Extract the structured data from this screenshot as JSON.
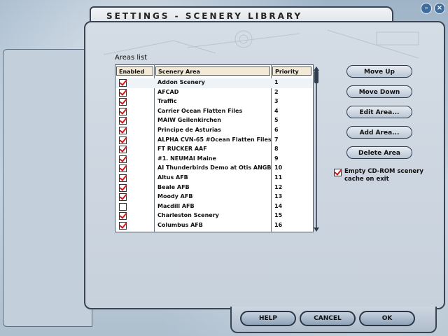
{
  "window": {
    "minimize_glyph": "–",
    "close_glyph": "×"
  },
  "title": "SETTINGS - SCENERY LIBRARY",
  "areas_label": "Areas list",
  "columns": {
    "enabled": "Enabled",
    "scenery_area": "Scenery Area",
    "priority": "Priority"
  },
  "rows": [
    {
      "name": "Addon Scenery",
      "priority": "1",
      "enabled": true
    },
    {
      "name": "AFCAD",
      "priority": "2",
      "enabled": true
    },
    {
      "name": "Traffic",
      "priority": "3",
      "enabled": true
    },
    {
      "name": "Carrier Ocean Flatten Files",
      "priority": "4",
      "enabled": true
    },
    {
      "name": "MAIW Geilenkirchen",
      "priority": "5",
      "enabled": true
    },
    {
      "name": "Principe de Asturias",
      "priority": "6",
      "enabled": true
    },
    {
      "name": "ALPHA CVN-65 #Ocean Flatten Files",
      "priority": "7",
      "enabled": true
    },
    {
      "name": "FT RUCKER AAF",
      "priority": "8",
      "enabled": true
    },
    {
      "name": "#1. NEUMAI Maine",
      "priority": "9",
      "enabled": true
    },
    {
      "name": "AI Thunderbirds Demo at Otis ANGB",
      "priority": "10",
      "enabled": true
    },
    {
      "name": "Altus AFB",
      "priority": "11",
      "enabled": true
    },
    {
      "name": "Beale AFB",
      "priority": "12",
      "enabled": true
    },
    {
      "name": "Moody AFB",
      "priority": "13",
      "enabled": true
    },
    {
      "name": "Macdill AFB",
      "priority": "14",
      "enabled": false
    },
    {
      "name": "Charleston Scenery",
      "priority": "15",
      "enabled": true
    },
    {
      "name": "Columbus AFB",
      "priority": "16",
      "enabled": true
    }
  ],
  "side_buttons": [
    "Move Up",
    "Move Down",
    "Edit Area...",
    "Add Area...",
    "Delete Area"
  ],
  "empty_cd": {
    "line1": "Empty CD-ROM scenery",
    "line2": "cache on exit",
    "checked": true
  },
  "bottom_buttons": {
    "help": "HELP",
    "cancel": "CANCEL",
    "ok": "OK"
  },
  "icons": {
    "minimize": "minimize-icon",
    "close": "close-icon",
    "checkbox": "checkmark-icon"
  },
  "colors": {
    "check": "#d01818",
    "header_bg": "#f2ead6",
    "panel": "#c7d1dc"
  }
}
